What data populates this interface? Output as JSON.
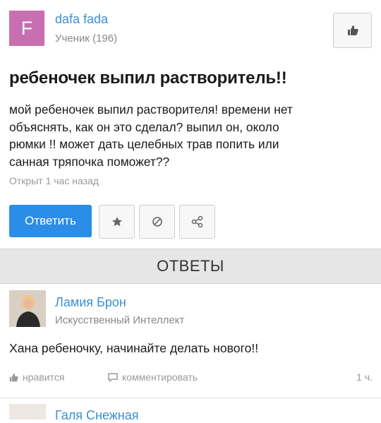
{
  "question": {
    "author": {
      "initial": "F",
      "name": "dafa fada",
      "rank": "Ученик (196)"
    },
    "title": "ребеночек выпил растворитель!!",
    "body_lines": [
      "мой ребеночек выпил растворителя! времени нет",
      "объяснять, как он это сделал? выпил он, около",
      "рюмки !! может дать целебных трав попить или",
      "санная тряпочка поможет??"
    ],
    "time": "Открыт 1 час назад",
    "answer_button": "Ответить"
  },
  "answers_header": "ОТВЕТЫ",
  "answer": {
    "name": "Ламия Брон",
    "rank": "Искусственный Интеллект",
    "text": "Хана ребеночку, начинайте делать нового!!",
    "like_label": "нравится",
    "comment_label": "комментировать",
    "time": "1 ч."
  },
  "next_answer": {
    "name": "Галя Снежная"
  },
  "colors": {
    "accent": "#2a8ee6",
    "link": "#3b8fd6",
    "avatar_bg": "#c76fb0"
  },
  "icons": [
    "thumbs-up-icon",
    "star-icon",
    "block-icon",
    "share-icon",
    "comment-icon"
  ]
}
